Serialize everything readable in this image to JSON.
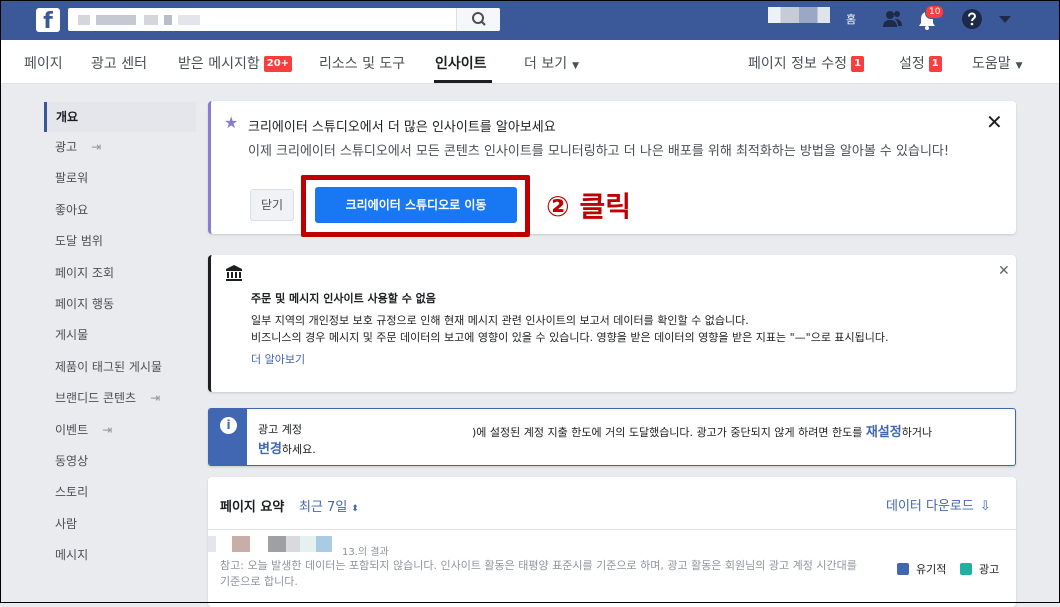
{
  "topbar": {
    "logo": "f",
    "home_label": "홈",
    "notification_count": "10"
  },
  "pagenav": {
    "items": [
      {
        "label": "페이지"
      },
      {
        "label": "광고 센터"
      },
      {
        "label": "받은 메시지함",
        "badge": "20+"
      },
      {
        "label": "리소스 및 도구"
      },
      {
        "label": "인사이트"
      },
      {
        "label": "더 보기"
      }
    ],
    "right": [
      {
        "label": "페이지 정보 수정",
        "badge": "1"
      },
      {
        "label": "설정",
        "badge": "1"
      },
      {
        "label": "도움말"
      }
    ]
  },
  "sidebar": {
    "items": [
      {
        "label": "개요"
      },
      {
        "label": "광고"
      },
      {
        "label": "팔로워"
      },
      {
        "label": "좋아요"
      },
      {
        "label": "도달 범위"
      },
      {
        "label": "페이지 조회"
      },
      {
        "label": "페이지 행동"
      },
      {
        "label": "게시물"
      },
      {
        "label": "제품이 태그된 게시물"
      },
      {
        "label": "브랜디드 콘텐츠"
      },
      {
        "label": "이벤트"
      },
      {
        "label": "동영상"
      },
      {
        "label": "스토리"
      },
      {
        "label": "사람"
      },
      {
        "label": "메시지"
      }
    ]
  },
  "creator_card": {
    "title": "크리에이터 스튜디오에서 더 많은 인사이트를 알아보세요",
    "description": "이제 크리에이터 스튜디오에서 모든 콘텐츠 인사이트를 모니터링하고 더 나은 배포를 위해 최적화하는 방법을 알아볼 수 있습니다!",
    "close_label": "닫기",
    "cta_label": "크리에이터 스튜디오로 이동"
  },
  "annotation": "② 클릭",
  "notice_card": {
    "title": "주문 및 메시지 인사이트 사용할 수 없음",
    "line1": "일부 지역의 개인정보 보호 규정으로 인해 현재 메시지 관련 인사이트의 보고서 데이터를 확인할 수 없습니다.",
    "line2": "비즈니스의 경우 메시지 및 주문 데이터의 보고에 영향이 있을 수 있습니다. 영향을 받은 데이터의 영향을 받은 지표는 \"—\"으로 표시됩니다.",
    "link": "더 알아보기"
  },
  "ad_card": {
    "prefix": "광고 계정",
    "middle": ")에 설정된 계정 지출 한도에 거의 도달했습니다. 광고가 중단되지 않게 하려면 한도를 ",
    "link1": "재설정",
    "tail1": "하거나",
    "link2": "변경",
    "tail2": "하세요."
  },
  "summary": {
    "title": "페이지 요약",
    "period": "최근 7일",
    "download": "데이터 다운로드",
    "result_suffix": "13.의 결과",
    "note": "참고: 오늘 발생한 데이터는 포함되지 않습니다. 인사이트 활동은 태평양 표준시를 기준으로 하며, 광고 활동은 회원님의 광고 계정 시간대를 기준으로 합니다.",
    "legend": [
      {
        "label": "유기적",
        "color": "#4267b2"
      },
      {
        "label": "광고",
        "color": "#20b0a0"
      }
    ]
  }
}
